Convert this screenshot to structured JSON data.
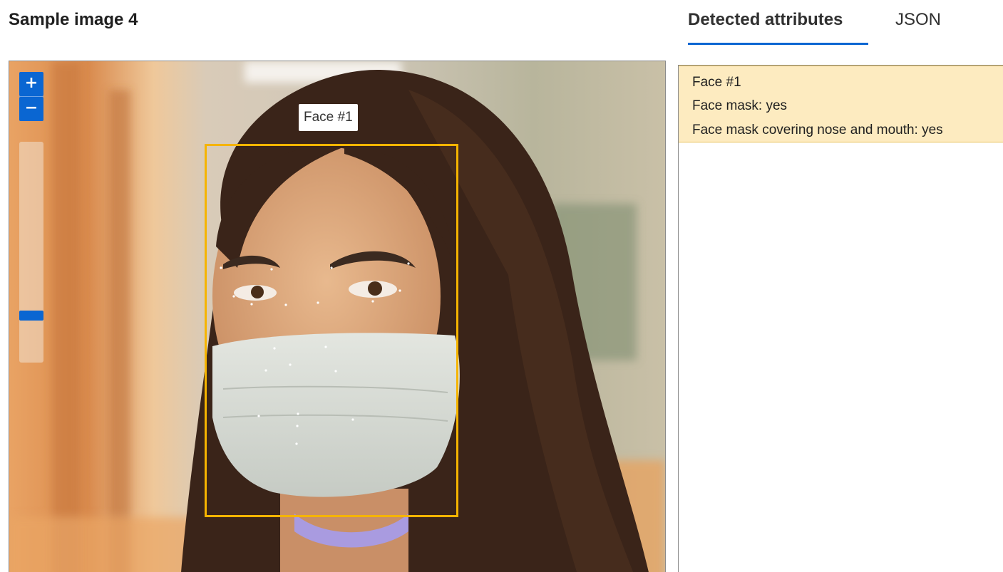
{
  "page": {
    "title": "Sample image 4"
  },
  "tabs": [
    {
      "label": "Detected attributes",
      "active": true
    },
    {
      "label": "JSON",
      "active": false
    }
  ],
  "viewer": {
    "zoom_in_label": "+",
    "zoom_out_label": "−",
    "zoom_level": 0.2,
    "face_tag": "Face #1"
  },
  "results": {
    "faces": [
      {
        "title": "Face #1",
        "mask": "Face mask: yes",
        "coverage": "Face mask covering nose and mouth: yes"
      }
    ]
  },
  "colors": {
    "accent": "#0a66d2",
    "face_box": "#f5b400",
    "result_highlight": "#fdebc0"
  }
}
